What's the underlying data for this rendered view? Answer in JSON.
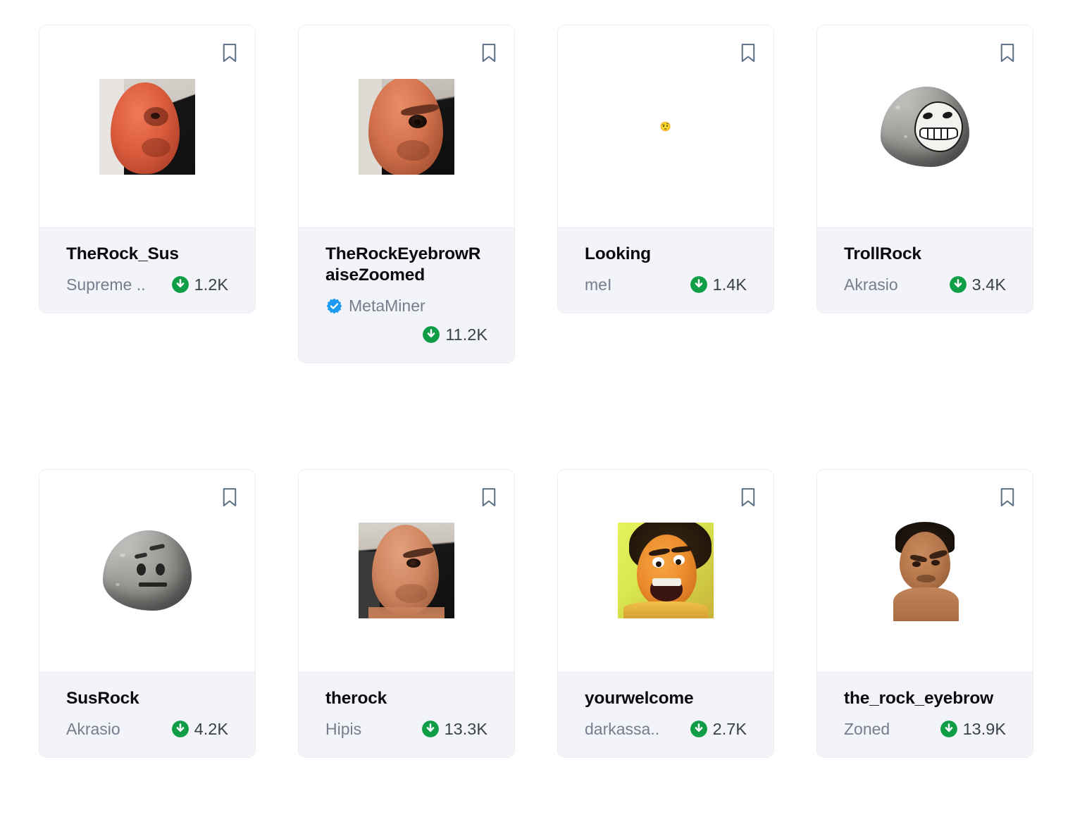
{
  "page": {
    "background_color": "#ffffff",
    "layout": "card-grid",
    "columns": 4,
    "rows": 2
  },
  "theme": {
    "card_background": "#ffffff",
    "card_border": "#eceef3",
    "footer_background": "#f2f4f9",
    "title_color": "#0b0b0e",
    "author_color": "#767d8c",
    "downloads_color": "#3b3f48",
    "download_icon_color": "#0f9d46",
    "verified_badge_color": "#1d9bf0",
    "bookmark_icon_color": "#5b7086"
  },
  "icons": {
    "bookmark": "bookmark-icon",
    "download": "download-icon",
    "verified": "verified-badge-icon"
  },
  "cards": [
    {
      "id": "card-1",
      "title": "TheRock_Sus",
      "author": "Supreme ..",
      "verified": false,
      "downloads": "1.2K",
      "media_type": "photo",
      "media_name": "the-rock-sus-red-tinted-face-photo",
      "bookmarked": false
    },
    {
      "id": "card-2",
      "title": "TheRockEyebrowRaiseZoomed",
      "author": "MetaMiner",
      "verified": true,
      "downloads": "11.2K",
      "media_type": "photo",
      "media_name": "the-rock-eyebrow-raise-zoomed-photo",
      "bookmarked": false
    },
    {
      "id": "card-3",
      "title": "Looking",
      "author": "meI",
      "verified": false,
      "downloads": "1.4K",
      "media_type": "emoji",
      "media_name": "raised-eyebrow-face-emoji",
      "emoji": "🤨",
      "bookmarked": false
    },
    {
      "id": "card-4",
      "title": "TrollRock",
      "author": "Akrasio",
      "verified": false,
      "downloads": "3.4K",
      "media_type": "rock-troll",
      "media_name": "troll-face-rock-illustration",
      "bookmarked": false
    },
    {
      "id": "card-5",
      "title": "SusRock",
      "author": "Akrasio",
      "verified": false,
      "downloads": "4.2K",
      "media_type": "rock-sus",
      "media_name": "suspicious-face-rock-illustration",
      "bookmarked": false
    },
    {
      "id": "card-6",
      "title": "therock",
      "author": "Hipis",
      "verified": false,
      "downloads": "13.3K",
      "media_type": "photo",
      "media_name": "the-rock-eyebrow-raise-photo",
      "bookmarked": false
    },
    {
      "id": "card-7",
      "title": "yourwelcome",
      "author": "darkassa..",
      "verified": false,
      "downloads": "2.7K",
      "media_type": "photo",
      "media_name": "maui-youre-welcome-cartoon-photo",
      "bookmarked": false
    },
    {
      "id": "card-8",
      "title": "the_rock_eyebrow",
      "author": "Zoned",
      "verified": false,
      "downloads": "13.9K",
      "media_type": "photo",
      "media_name": "young-the-rock-eyebrow-raise-photo",
      "bookmarked": false
    }
  ]
}
